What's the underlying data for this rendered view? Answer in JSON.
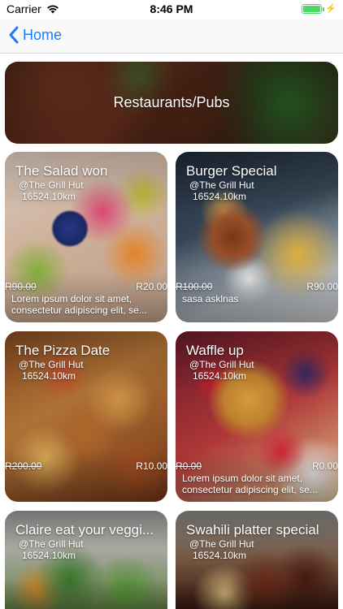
{
  "status_bar": {
    "carrier": "Carrier",
    "time": "8:46 PM",
    "battery_level": 1.0,
    "battery_color": "#4cd964"
  },
  "nav": {
    "back_label": "Home",
    "accent_color": "#1a7cf6"
  },
  "banner": {
    "title": "Restaurants/Pubs"
  },
  "cards": [
    {
      "title": "The Salad won",
      "venue": "@The Grill Hut",
      "distance": "16524.10km",
      "old_price": "R90.00",
      "new_price": "R20.00",
      "description": "Lorem ipsum dolor sit amet, consectetur adipiscing elit, se..."
    },
    {
      "title": "Burger Special",
      "venue": "@The Grill Hut",
      "distance": "16524.10km",
      "old_price": "R100.00",
      "new_price": "R90.00",
      "description": "sasa asklnas"
    },
    {
      "title": "The Pizza Date",
      "venue": "@The Grill Hut",
      "distance": "16524.10km",
      "old_price": "R200.00",
      "new_price": "R10.00",
      "description": ""
    },
    {
      "title": "Waffle up",
      "venue": "@The Grill Hut",
      "distance": "16524.10km",
      "old_price": "R0.00",
      "new_price": "R0.00",
      "description": "Lorem ipsum dolor sit amet, consectetur adipiscing elit, se..."
    },
    {
      "title": "Claire eat your veggi...",
      "venue": "@The Grill Hut",
      "distance": "16524.10km"
    },
    {
      "title": "Swahili platter special",
      "venue": "@The Grill Hut",
      "distance": "16524.10km"
    }
  ]
}
